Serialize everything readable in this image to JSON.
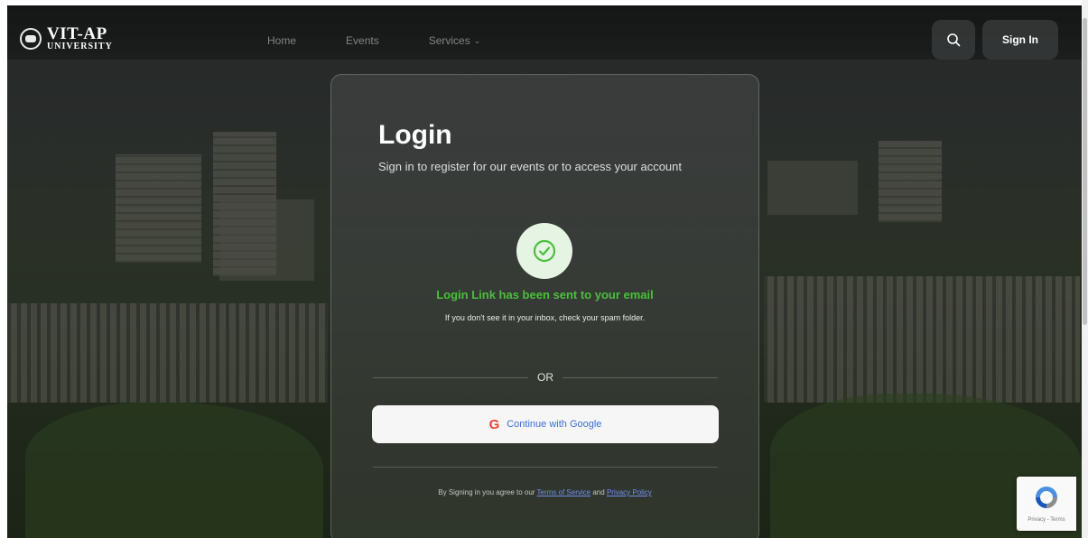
{
  "brand": {
    "name": "VIT-AP",
    "sub": "UNIVERSITY"
  },
  "nav": {
    "links": [
      {
        "label": "Home"
      },
      {
        "label": "Events"
      },
      {
        "label": "Services"
      }
    ],
    "signin_label": "Sign In"
  },
  "login": {
    "title": "Login",
    "subtitle": "Sign in to register for our events or to access your account",
    "success_title": "Login Link has been sent to your email",
    "success_note": "If you don't see it in your inbox, check your spam folder.",
    "or_label": "OR",
    "google_label": "Continue with Google",
    "terms_prefix": "By Signing in you agree to our",
    "terms_link": "Terms of Service",
    "terms_and": "and",
    "privacy_link": "Privacy Policy"
  },
  "recaptcha": {
    "text": "Privacy - Terms"
  },
  "colors": {
    "success": "#4bbf3d",
    "link": "#6f8ff0",
    "google_red": "#ea4335"
  },
  "icons": {
    "search": "search-icon",
    "check": "check-circle-icon",
    "google": "google-icon",
    "chevron": "chevron-down-icon"
  }
}
